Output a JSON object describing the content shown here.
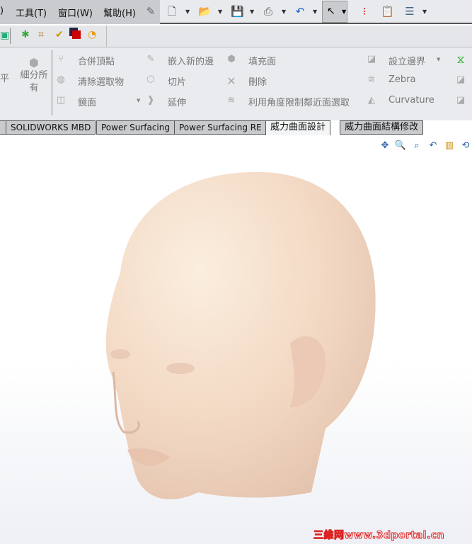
{
  "menubar": {
    "items": [
      ")",
      "工具(T)",
      "窗口(W)",
      "幫助(H)"
    ]
  },
  "ribbon": {
    "left_partial": "平",
    "subdivide_all": "細分所有",
    "col1": [
      "合併頂點",
      "清除選取物",
      "鏡面"
    ],
    "col2": [
      "嵌入新的邊",
      "切片",
      "延伸"
    ],
    "col3": [
      "填充面",
      "刪除",
      "利用角度限制鄰近面選取"
    ],
    "col4": [
      "設立邊界",
      "Zebra",
      "Curvature"
    ]
  },
  "tabs": [
    {
      "label": "SOLIDWORKS MBD"
    },
    {
      "label": "Power Surfacing"
    },
    {
      "label": "Power Surfacing RE"
    },
    {
      "label": "威力曲面設計",
      "active": true
    },
    {
      "label": "威力曲面結構修改"
    }
  ],
  "watermark": "三維网www.3dportal.cn",
  "colors": {
    "skin": "#f3dcc6",
    "accent": "#2a5fa5",
    "watermark": "#dd2222"
  }
}
